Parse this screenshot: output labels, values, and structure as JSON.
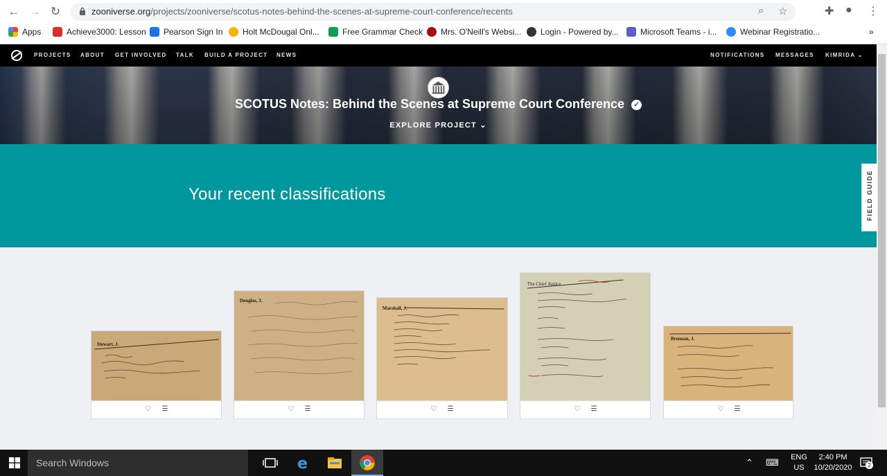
{
  "browser": {
    "url_host": "zooniverse.org",
    "url_path": "/projects/zooniverse/scotus-notes-behind-the-scenes-at-supreme-court-conference/recents",
    "bookmarks": [
      {
        "label": "Apps",
        "color": "#4285f4"
      },
      {
        "label": "Achieve3000: Lesson",
        "color": "#d93025"
      },
      {
        "label": "Pearson Sign In",
        "color": "#1a73e8"
      },
      {
        "label": "Holt McDougal Onl...",
        "color": "#f4b400"
      },
      {
        "label": "Free Grammar Check",
        "color": "#0f9d58"
      },
      {
        "label": "Mrs. O'Neill's Websi...",
        "color": "#a50e0e"
      },
      {
        "label": "Login - Powered by...",
        "color": "#333333"
      },
      {
        "label": "Microsoft Teams - i...",
        "color": "#5b5fc7"
      },
      {
        "label": "Webinar Registratio...",
        "color": "#2d8cff"
      }
    ],
    "more_bookmarks": "»"
  },
  "sitenav": {
    "left": [
      "PROJECTS",
      "ABOUT",
      "GET INVOLVED",
      "TALK",
      "BUILD A PROJECT",
      "NEWS"
    ],
    "right": [
      "NOTIFICATIONS",
      "MESSAGES",
      "KIMRIDA"
    ]
  },
  "hero": {
    "title": "SCOTUS Notes: Behind the Scenes at Supreme Court Conference",
    "explore": "EXPLORE PROJECT"
  },
  "band": {
    "heading": "Your recent classifications",
    "field_guide": "FIELD GUIDE"
  },
  "cards": [
    {
      "header": "Stewart, J.",
      "paper": "#c9a978"
    },
    {
      "header": "Douglas, J.",
      "paper": "#cdb083"
    },
    {
      "header": "Marshall, J.",
      "paper": "#dcbd8d"
    },
    {
      "header": "The Chief Justice",
      "paper": "#d3d0b6"
    },
    {
      "header": "Brennan, J.",
      "paper": "#d9b37c"
    }
  ],
  "taskbar": {
    "search_placeholder": "Search Windows",
    "lang": "ENG",
    "region": "US",
    "time": "2:40 PM",
    "date": "10/20/2020",
    "notifications": "2"
  }
}
